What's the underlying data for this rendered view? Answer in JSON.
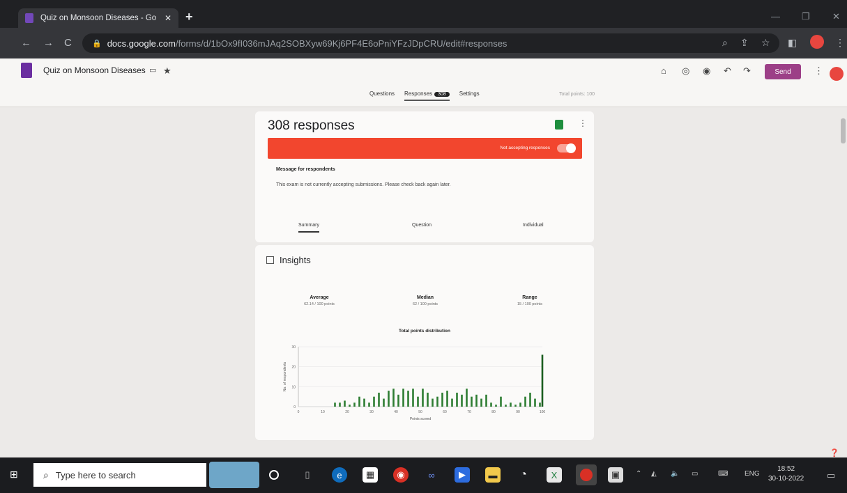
{
  "browser": {
    "tab_title": "Quiz on Monsoon Diseases - Go",
    "url_host": "docs.google.com",
    "url_path": "/forms/d/1bOx9fI036mJAq2SOBXyw69Kj6PF4E6oPniYFzJDpCRU/edit#responses"
  },
  "form": {
    "title": "Quiz on Monsoon Diseases",
    "send_label": "Send",
    "tabs": {
      "questions": "Questions",
      "responses": "Responses",
      "responses_count": "308",
      "settings": "Settings"
    },
    "total_points": "Total points: 100"
  },
  "responses": {
    "title": "308 responses",
    "accepting_label": "Not accepting responses",
    "message_heading": "Message for respondents",
    "message_text": "This exam is not currently accepting submissions. Please check back again later.",
    "subtabs": [
      "Summary",
      "Question",
      "Individual"
    ]
  },
  "insights": {
    "heading": "Insights",
    "average_label": "Average",
    "average_value": "62.14 / 100 points",
    "median_label": "Median",
    "median_value": "62 / 100 points",
    "range_label": "Range",
    "range_value": "15 / 100 points"
  },
  "chart_data": {
    "type": "bar",
    "title": "Total points distribution",
    "xlabel": "Points scored",
    "ylabel": "No. of respondents",
    "xlim": [
      0,
      100
    ],
    "ylim": [
      0,
      30
    ],
    "xticks": [
      0,
      10,
      20,
      30,
      40,
      50,
      60,
      70,
      80,
      90,
      100
    ],
    "yticks": [
      0,
      10,
      20,
      30
    ],
    "x": [
      15,
      17,
      19,
      21,
      23,
      25,
      27,
      29,
      31,
      33,
      35,
      37,
      39,
      41,
      43,
      45,
      47,
      49,
      51,
      53,
      55,
      57,
      59,
      61,
      63,
      65,
      67,
      69,
      71,
      73,
      75,
      77,
      79,
      81,
      83,
      85,
      87,
      89,
      91,
      93,
      95,
      97,
      99,
      100
    ],
    "values": [
      2,
      2,
      3,
      1,
      2,
      5,
      4,
      2,
      5,
      7,
      4,
      8,
      9,
      6,
      9,
      8,
      9,
      5,
      9,
      7,
      4,
      5,
      7,
      8,
      4,
      7,
      6,
      9,
      5,
      6,
      4,
      6,
      2,
      1,
      5,
      1,
      2,
      1,
      2,
      5,
      7,
      4,
      2,
      26
    ]
  },
  "taskbar": {
    "search_placeholder": "Type here to search",
    "lang": "ENG",
    "time": "18:52",
    "date": "30-10-2022"
  },
  "colors": {
    "accent_purple": "#9c3f87",
    "banner_red": "#f2462e",
    "bar_green": "#2e7d32"
  }
}
